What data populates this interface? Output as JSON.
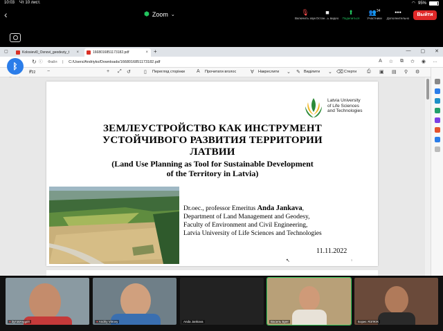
{
  "status_bar": {
    "time": "10:03",
    "date": "Чт 10 лист.",
    "battery": "95%"
  },
  "zoom": {
    "title": "Zoom",
    "tools": [
      {
        "icon": "mute-icon",
        "label": "Включить звук"
      },
      {
        "icon": "video-icon",
        "label": "Остан...ь видео"
      },
      {
        "icon": "share-icon",
        "label": "Поделиться"
      },
      {
        "icon": "participants-icon",
        "label": "Участники",
        "count": "34"
      },
      {
        "icon": "more-icon",
        "label": "Дополнительно"
      }
    ],
    "leave_label": "Выйти"
  },
  "browser": {
    "tabs": [
      {
        "label": "Kolosievi0_Osnovi_geodeziy_t",
        "active": false
      },
      {
        "label": "1668016851173182.pdf",
        "active": true
      }
    ],
    "url_label": "Файл",
    "url": "C:/Users/Andriyko/Downloads/1668016851173182.pdf",
    "pdf_toolbar": {
      "page_info": "з 22",
      "zoom_minus": "−",
      "zoom_plus": "+",
      "view_label": "Перегляд сторінки",
      "read_label": "Прочитати вголос",
      "draw_label": "Накреслити",
      "highlight_label": "Виділити",
      "erase_label": "Стерти"
    },
    "bluetooth_label": "Bluetooth"
  },
  "slide": {
    "logo_text": [
      "Latvia University",
      "of Life Sciences",
      "and Technologies"
    ],
    "title_ru": [
      "ЗЕМЛЕУСТРОЙСТВО КАК ИНСТРУМЕНТ",
      "УСТОЙЧИВОГО РАЗВИТИЯ ТЕРРИТОРИИ",
      "ЛАТВИИ"
    ],
    "title_en": [
      "(Land Use Planning as Tool for Sustainable Development",
      "of the Territory in Latvia)"
    ],
    "author_prefix": "Dr.oec., professor  Emeritus ",
    "author_name": "Anda Jankava",
    "author_suffix": ",",
    "author_lines": [
      "Department of Land Management and Geodesy,",
      "Faculty of Environment and Civil Engineering,",
      "Latvia University of Life Sciences and Technologies"
    ],
    "date": "11.11.2022",
    "page_number": "1"
  },
  "participants": [
    {
      "name": "ЗутовАндрій",
      "muted": true,
      "speaking": false
    },
    {
      "name": "Andriy Vitrovy",
      "muted": true,
      "speaking": false
    },
    {
      "name": "Anda Jankava",
      "muted": false,
      "speaking": false
    },
    {
      "name": "Василь Брег",
      "muted": false,
      "speaking": true
    },
    {
      "name": "Борис ЯЗЛЮК",
      "muted": false,
      "speaking": false
    }
  ]
}
